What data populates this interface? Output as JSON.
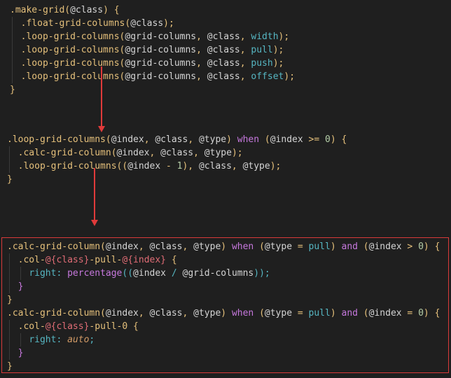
{
  "code": {
    "block1": [
      ".make-grid(@class) {",
      "  .float-grid-columns(@class);",
      "  .loop-grid-columns(@grid-columns, @class, width);",
      "  .loop-grid-columns(@grid-columns, @class, pull);",
      "  .loop-grid-columns(@grid-columns, @class, push);",
      "  .loop-grid-columns(@grid-columns, @class, offset);",
      "}"
    ],
    "block2": [
      ".loop-grid-columns(@index, @class, @type) when (@index >= 0) {",
      "  .calc-grid-column(@index, @class, @type);",
      "  .loop-grid-columns((@index - 1), @class, @type);",
      "}"
    ],
    "block3": [
      ".calc-grid-column(@index, @class, @type) when (@type = pull) and (@index > 0) {",
      "  .col-@{class}-pull-@{index} {",
      "    right: percentage((@index / @grid-columns));",
      "  }",
      "}",
      ".calc-grid-column(@index, @class, @type) when (@type = pull) and (@index = 0) {",
      "  .col-@{class}-pull-0 {",
      "    right: auto;",
      "  }",
      "}"
    ]
  },
  "colors": {
    "background": "#1f1f1f",
    "annotation": "#e03a3a",
    "selector": "#e5c07b",
    "keyword": "#c678dd",
    "property": "#56b6c2",
    "number": "#b5cea8"
  }
}
